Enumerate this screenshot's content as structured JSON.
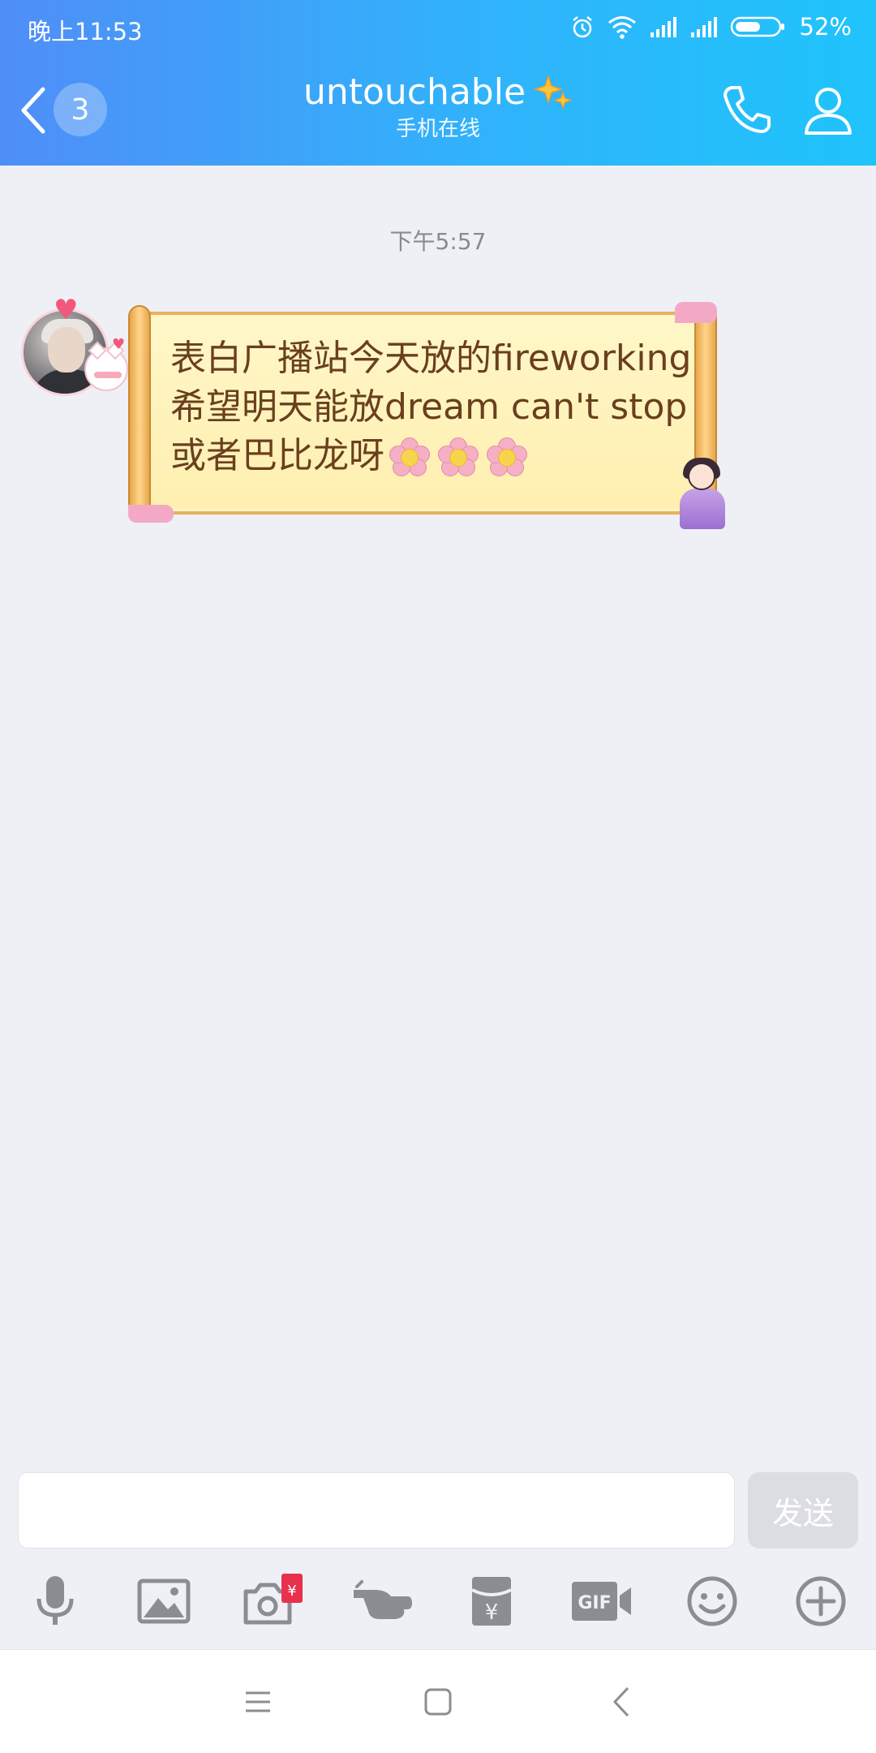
{
  "status_bar": {
    "time": "晚上11:53",
    "battery_percent": "52%",
    "icons": [
      "alarm-icon",
      "wifi-icon",
      "signal-icon",
      "signal-icon",
      "battery-icon"
    ]
  },
  "header": {
    "unread_count": "3",
    "title": "untouchable",
    "title_decoration": "sparkle-icon",
    "subtitle": "手机在线",
    "accent_colors": [
      "#4f8ef7",
      "#1fc4fb"
    ]
  },
  "messages": [
    {
      "time": "下午5:57",
      "sender": "contact",
      "bubble_style": "scroll",
      "lines": [
        "表白广播站今天放的fireworking",
        "希望明天能放dream can't stop",
        "或者巴比龙呀"
      ],
      "emoji": [
        "cherry-blossom",
        "cherry-blossom",
        "cherry-blossom"
      ]
    }
  ],
  "composer": {
    "input_value": "",
    "send_label": "发送"
  },
  "toolbar": {
    "items": [
      "voice-icon",
      "image-icon",
      "camera-redpacket-icon",
      "poke-icon",
      "red-packet-icon",
      "gif-icon",
      "emoji-icon",
      "plus-icon"
    ]
  },
  "system_nav": {
    "items": [
      "menu-icon",
      "home-icon",
      "back-icon"
    ]
  }
}
